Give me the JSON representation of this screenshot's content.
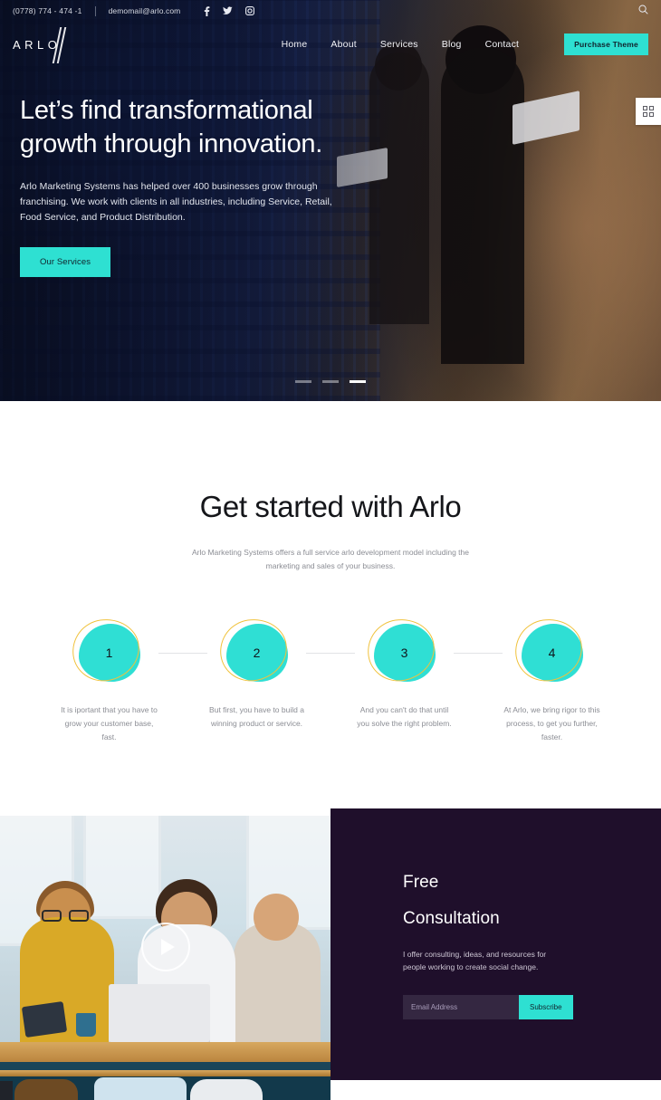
{
  "topbar": {
    "phone": "(0778) 774 - 474 -1",
    "email": "demomail@arlo.com",
    "social": [
      {
        "name": "facebook-icon",
        "glyph": "f"
      },
      {
        "name": "twitter-icon",
        "glyph": "ᵥ"
      },
      {
        "name": "instagram-icon",
        "glyph": "▣"
      }
    ],
    "search_icon": "search-icon"
  },
  "header": {
    "logo": "ARLO",
    "nav": [
      {
        "label": "Home"
      },
      {
        "label": "About"
      },
      {
        "label": "Services"
      },
      {
        "label": "Blog"
      },
      {
        "label": "Contact"
      }
    ],
    "purchase_button": "Purchase Theme"
  },
  "hero": {
    "heading_line1": "Let’s find transformational",
    "heading_line2": "growth through innovation.",
    "paragraph": "Arlo Marketing Systems has helped over 400 businesses grow through franchising. We work with clients in all industries, including Service, Retail, Food Service, and Product Distribution.",
    "cta": "Our Services",
    "slides": 3,
    "active_slide": 3,
    "grid_toggle_icon": "grid-icon"
  },
  "started": {
    "title": "Get started with Arlo",
    "subtitle": "Arlo Marketing Systems offers a full service arlo development model including the marketing and sales of your business.",
    "steps": [
      {
        "number": "1",
        "text": "It is iportant that you have to grow your customer base, fast."
      },
      {
        "number": "2",
        "text": "But first, you have to build a winning product or service."
      },
      {
        "number": "3",
        "text": "And you can't do that until you solve the right problem."
      },
      {
        "number": "4",
        "text": "At Arlo, we bring rigor to this process, to get you further, faster."
      }
    ]
  },
  "consultation": {
    "title_line1": "Free",
    "title_line2": "Consultation",
    "description": "I offer consulting, ideas, and resources for people working to create social change.",
    "email_placeholder": "Email Address",
    "email_value": "",
    "subscribe_button": "Subscribe",
    "play_icon": "play-icon"
  },
  "colors": {
    "accent": "#2ee0d2",
    "panel": "#1f0f2b",
    "blob": "#2fdfd4",
    "blob_outline": "#f0c23c"
  }
}
